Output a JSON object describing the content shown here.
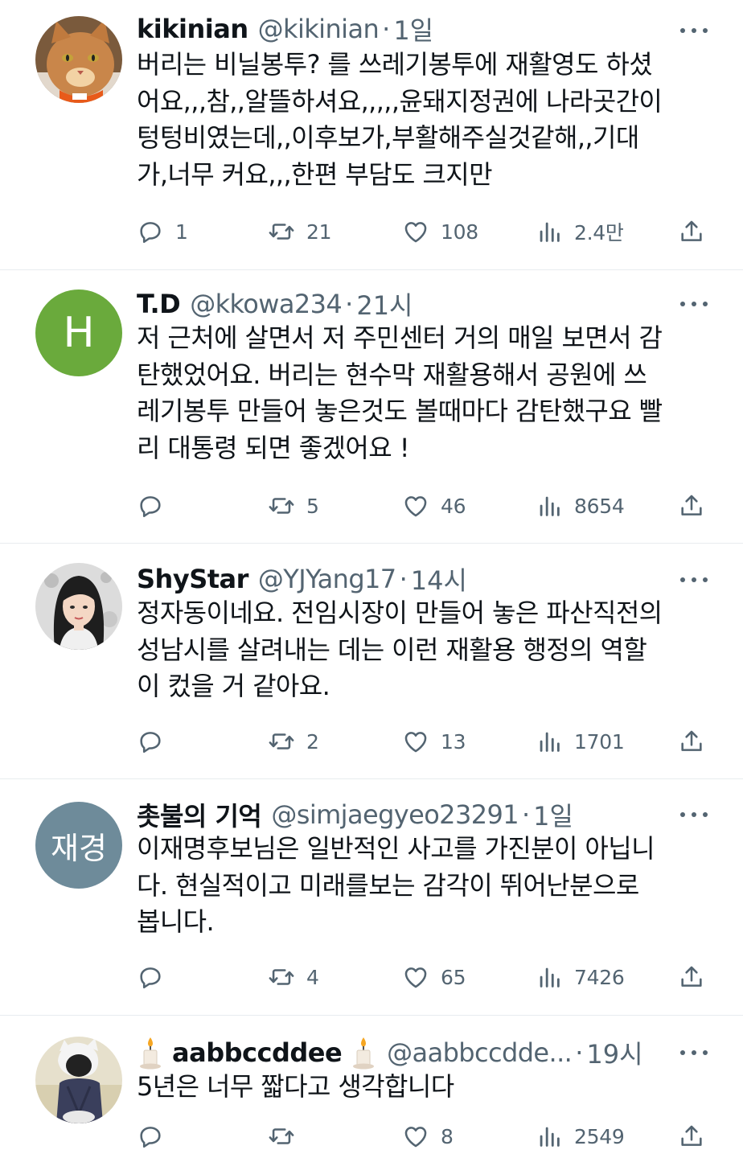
{
  "tweets": [
    {
      "name": "kikinian",
      "handle": "@kikinian",
      "time": "1일",
      "lines": [
        "버리는 비닐봉투? 를 쓰레기봉투에 재활영도 하셨",
        "어요,,,참,,알뜰하셔요,,,,,윤돼지정권에 나라곳간이",
        "텅텅비였는데,,이후보가,부활해주실것같해,,기대",
        "가,너무 커요,,,한편 부담도 크지만"
      ],
      "replies": "1",
      "retweets": "21",
      "likes": "108",
      "views": "2.4만",
      "avatar": {
        "kind": "cat-photo",
        "colors": [
          "#c9864a",
          "#f2d2a4",
          "#e85a1a"
        ]
      }
    },
    {
      "name": "T.D",
      "handle": "@kkowa234",
      "time": "21시",
      "lines": [
        "저 근처에 살면서 저 주민센터 거의 매일 보면서 감",
        "탄했었어요. 버리는 현수막 재활용해서 공원에 쓰",
        "레기봉투 만들어 놓은것도 볼때마다 감탄했구요 빨",
        "리 대통령 되면 좋겠어요 !"
      ],
      "replies": "",
      "retweets": "5",
      "likes": "46",
      "views": "8654",
      "avatar": {
        "kind": "initials",
        "text": "H",
        "color": "#6aaa3c"
      }
    },
    {
      "name": "ShyStar",
      "handle": "@YJYang17",
      "time": "14시",
      "lines": [
        "정자동이네요. 전임시장이 만들어 놓은 파산직전의",
        "성남시를 살려내는 데는 이런 재활용 행정의 역할",
        "이 컸을 거 같아요."
      ],
      "replies": "",
      "retweets": "2",
      "likes": "13",
      "views": "1701",
      "avatar": {
        "kind": "illustrated-woman",
        "colors": [
          "#dcdcdc",
          "#1e1e1e",
          "#f4d7c4"
        ]
      }
    },
    {
      "name": "촛불의 기억",
      "handle": "@simjaegyeo23291",
      "time": "1일",
      "lines": [
        "이재명후보님은 일반적인 사고를 가진분이 아닙니",
        "다. 현실적이고 미래를보는 감각이 뛰어난분으로",
        "봅니다."
      ],
      "replies": "",
      "retweets": "4",
      "likes": "65",
      "views": "7426",
      "avatar": {
        "kind": "initials",
        "text": "재경",
        "color": "#6e8b9a"
      }
    },
    {
      "name": "aabbccddee",
      "handle": "@aabbccdde...",
      "time": "19시",
      "lines": [
        "5년은 너무 짧다고 생각합니다"
      ],
      "replies": "",
      "retweets": "",
      "likes": "8",
      "views": "2549",
      "avatar": {
        "kind": "person-photo",
        "colors": [
          "#f0ead8",
          "#3a3f5c",
          "#e8e8e8"
        ]
      },
      "name_decoration": "candle-emoji"
    }
  ],
  "icons": {
    "reply": "reply-icon",
    "retweet": "retweet-icon",
    "like": "heart-icon",
    "views": "views-icon",
    "share": "share-icon",
    "more": "more-options-icon"
  },
  "colors": {
    "text": "#0f1419",
    "secondary": "#536471",
    "divider": "#e8ecef"
  }
}
